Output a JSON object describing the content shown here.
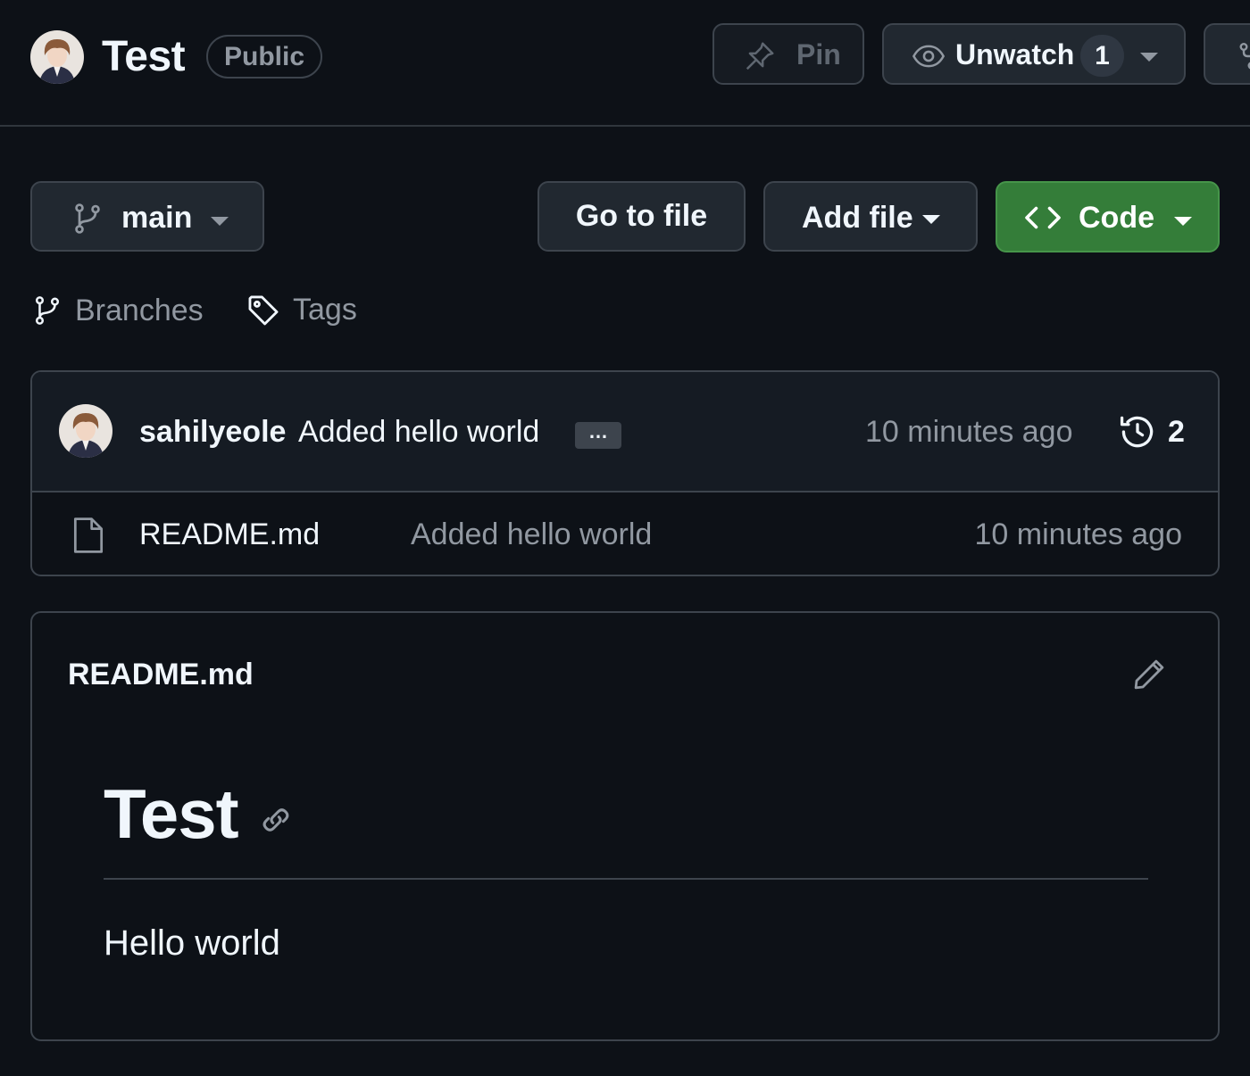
{
  "header": {
    "repo_name": "Test",
    "visibility": "Public",
    "pin_label": "Pin",
    "watch_label": "Unwatch",
    "watch_count": "1"
  },
  "toolbar": {
    "branch": "main",
    "go_to_file": "Go to file",
    "add_file": "Add file",
    "code": "Code",
    "code_color": "#347d39",
    "branches_label": "Branches",
    "tags_label": "Tags"
  },
  "latest_commit": {
    "author": "sahilyeole",
    "message": "Added hello world",
    "ellipsis": "…",
    "time": "10 minutes ago",
    "commit_count": "2"
  },
  "files": [
    {
      "icon": "file-icon",
      "name": "README.md",
      "last_commit": "Added hello world",
      "time": "10 minutes ago"
    }
  ],
  "readme": {
    "title": "README.md",
    "heading": "Test",
    "body": "Hello world"
  }
}
